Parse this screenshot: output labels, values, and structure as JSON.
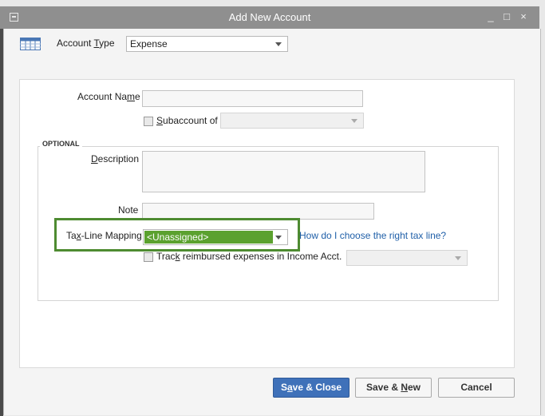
{
  "window": {
    "title": "Add New Account",
    "controls": {
      "minimize": "_",
      "maximize": "□",
      "close": "×"
    }
  },
  "account_type": {
    "label_pre": "Account ",
    "label_access": "T",
    "label_post": "ype",
    "value": "Expense",
    "icon": "account-ledger-icon"
  },
  "account_name": {
    "label_pre": "Account Na",
    "label_access": "m",
    "label_post": "e",
    "value": ""
  },
  "subaccount": {
    "label_access": "S",
    "label_post": "ubaccount of",
    "checked": false,
    "value": ""
  },
  "optional": {
    "section_label": "OPTIONAL",
    "description": {
      "label_access": "D",
      "label_post": "escription",
      "value": ""
    },
    "note": {
      "label": "Note",
      "value": ""
    },
    "tax_line": {
      "label_pre": "Ta",
      "label_access": "x",
      "label_post": "-Line Mapping",
      "value": "<Unassigned>",
      "help_link": "How do I choose the right tax line?",
      "highlight_color": "#4e8b31",
      "selected_bg": "#5ba12f"
    },
    "track_reimbursed": {
      "label_pre": "Trac",
      "label_access": "k",
      "label_post": " reimbursed expenses in Income Acct.",
      "checked": false,
      "value": ""
    }
  },
  "buttons": {
    "save_close": {
      "pre": "S",
      "access": "a",
      "post": "ve & Close"
    },
    "save_new": {
      "pre": "Save & ",
      "access": "N",
      "post": "ew"
    },
    "cancel": "Cancel"
  }
}
